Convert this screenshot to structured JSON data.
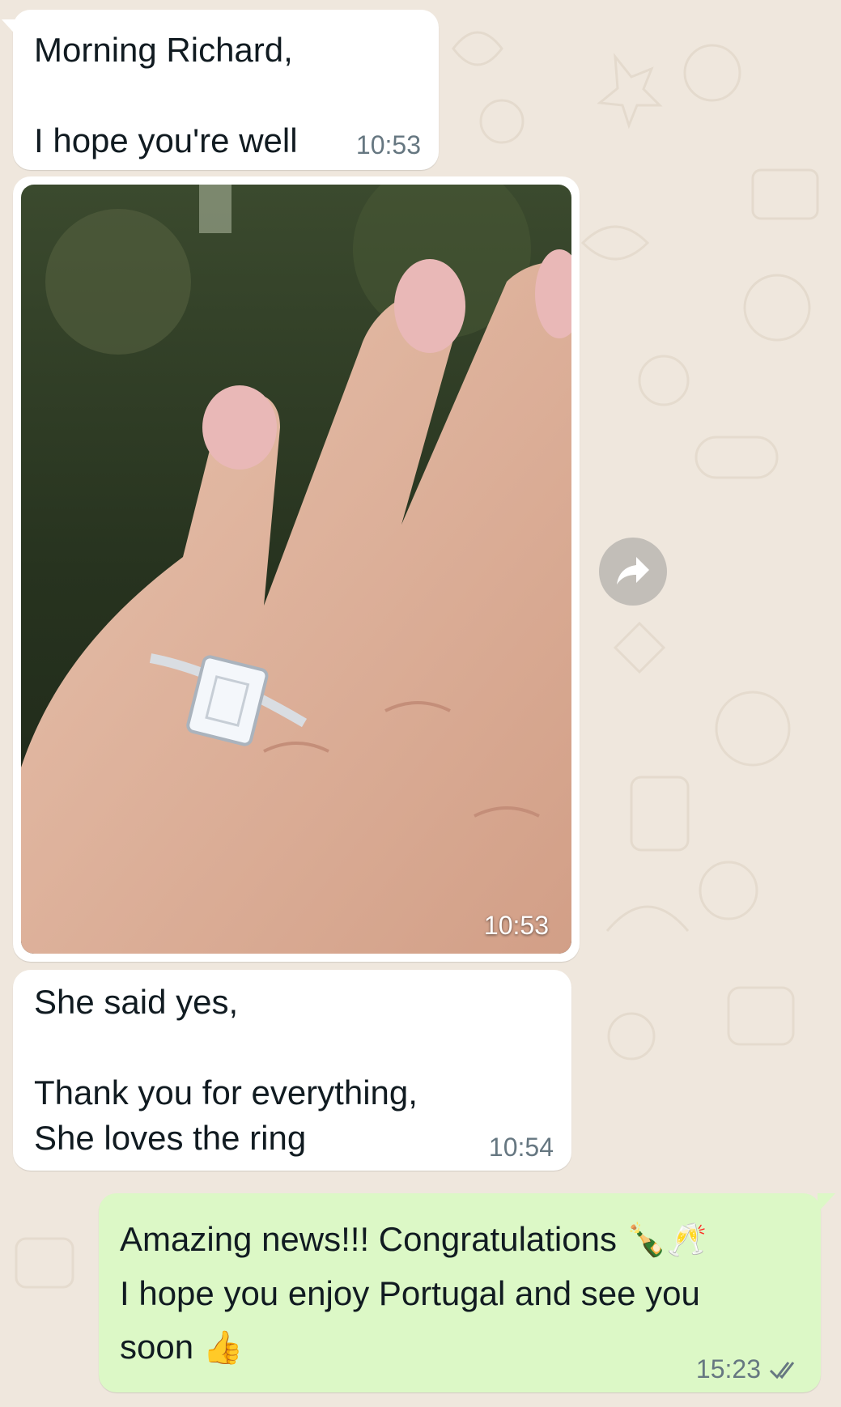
{
  "messages": [
    {
      "id": "m1",
      "direction": "incoming",
      "text": "Morning Richard,\n\nI hope you're well",
      "time": "10:53"
    },
    {
      "id": "m2",
      "direction": "incoming",
      "type": "image",
      "image": "engagement-ring-photo",
      "time": "10:53"
    },
    {
      "id": "m3",
      "direction": "incoming",
      "text": "She said yes,\n\nThank you for everything,\nShe loves the ring",
      "time": "10:54"
    },
    {
      "id": "m4",
      "direction": "outgoing",
      "line1": "Amazing news!!! Congratulations",
      "line2": "I hope you enjoy Portugal and see you",
      "line3": "soon",
      "emoji_champagne": "🍾",
      "emoji_glasses": "🥂",
      "emoji_thumbs": "👍",
      "time": "15:23",
      "status": "read"
    }
  ],
  "icons": {
    "forward": "forward-icon",
    "read_receipt": "double-check-icon"
  },
  "colors": {
    "incoming": "#ffffff",
    "outgoing": "#dcf8c6",
    "wallpaper": "#efe7dd",
    "read_tick": "#667781"
  }
}
